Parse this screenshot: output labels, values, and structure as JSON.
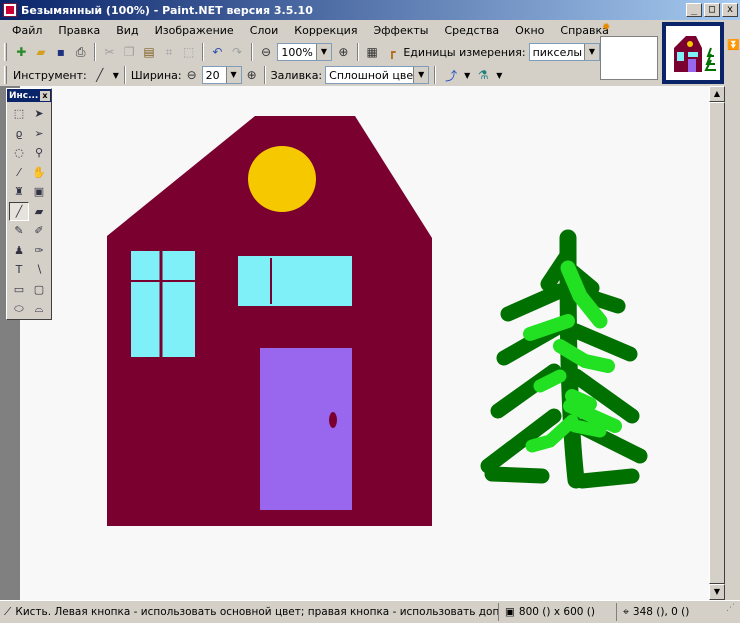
{
  "window": {
    "title": "Безымянный (100%) - Paint.NET версия 3.5.10",
    "minimize": "_",
    "maximize": "□",
    "close": "x"
  },
  "menu": [
    "Файл",
    "Правка",
    "Вид",
    "Изображение",
    "Слои",
    "Коррекция",
    "Эффекты",
    "Средства",
    "Окно",
    "Справка"
  ],
  "toolbar1": {
    "zoom_value": "100%",
    "units_label": "Единицы измерения:",
    "units_value": "пикселы"
  },
  "toolbar2": {
    "tool_label": "Инструмент:",
    "width_label": "Ширина:",
    "width_value": "20",
    "fill_label": "Заливка:",
    "fill_value": "Сплошной цвет"
  },
  "tools_window": {
    "title": "Инс...",
    "close": "x"
  },
  "status": {
    "hint": "Кисть. Левая кнопка - использовать основной цвет; правая кнопка - использовать дополнительный цвет.",
    "image_size": "800 () x 600 ()",
    "cursor_pos": "348 (), 0 ()"
  },
  "colors": {
    "house": "#7a0030",
    "sun": "#f5c800",
    "window": "#80f0f8",
    "door": "#9966ee",
    "tree_dark": "#007000",
    "tree_light": "#22e022",
    "titlebar": "#0a246a"
  }
}
